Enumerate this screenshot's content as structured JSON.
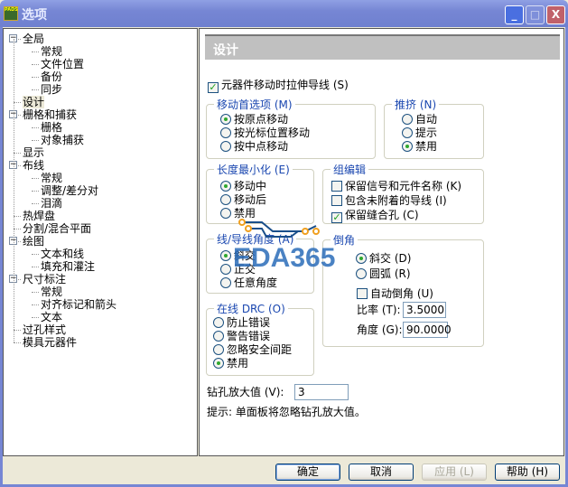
{
  "window": {
    "title": "选项",
    "icon_text": "PADS",
    "minimize": "_",
    "maximize": "□",
    "close": "X"
  },
  "tree": [
    {
      "label": "全局",
      "level": 0,
      "expanded": true
    },
    {
      "label": "常规",
      "level": 1
    },
    {
      "label": "文件位置",
      "level": 1
    },
    {
      "label": "备份",
      "level": 1
    },
    {
      "label": "同步",
      "level": 1
    },
    {
      "label": "设计",
      "level": 0,
      "selected": true
    },
    {
      "label": "栅格和捕获",
      "level": 0,
      "expanded": true
    },
    {
      "label": "栅格",
      "level": 1
    },
    {
      "label": "对象捕获",
      "level": 1
    },
    {
      "label": "显示",
      "level": 0
    },
    {
      "label": "布线",
      "level": 0,
      "expanded": true
    },
    {
      "label": "常规",
      "level": 1
    },
    {
      "label": "调整/差分对",
      "level": 1
    },
    {
      "label": "泪滴",
      "level": 1
    },
    {
      "label": "热焊盘",
      "level": 0
    },
    {
      "label": "分割/混合平面",
      "level": 0
    },
    {
      "label": "绘图",
      "level": 0,
      "expanded": true
    },
    {
      "label": "文本和线",
      "level": 1
    },
    {
      "label": "填充和灌注",
      "level": 1
    },
    {
      "label": "尺寸标注",
      "level": 0,
      "expanded": true
    },
    {
      "label": "常规",
      "level": 1
    },
    {
      "label": "对齐标记和箭头",
      "level": 1
    },
    {
      "label": "文本",
      "level": 1
    },
    {
      "label": "过孔样式",
      "level": 0
    },
    {
      "label": "模具元器件",
      "level": 0
    }
  ],
  "page": {
    "header": "设计",
    "stretch": {
      "label": "元器件移动时拉伸导线 (S)",
      "checked": true
    },
    "move_pref": {
      "title": "移动首选项 (M)",
      "options": [
        "按原点移动",
        "按光标位置移动",
        "按中点移动"
      ],
      "selected": 0
    },
    "push": {
      "title": "推挤 (N)",
      "options": [
        "自动",
        "提示",
        "禁用"
      ],
      "selected": 2
    },
    "length_min": {
      "title": "长度最小化 (E)",
      "options": [
        "移动中",
        "移动后",
        "禁用"
      ],
      "selected": 0
    },
    "group_edit": {
      "title": "组编辑",
      "options": [
        {
          "label": "保留信号和元件名称 (K)",
          "checked": false
        },
        {
          "label": "包含未附着的导线 (I)",
          "checked": false
        },
        {
          "label": "保留缝合孔 (C)",
          "checked": true
        }
      ]
    },
    "line_angle": {
      "title": "线/导线角度 (A)",
      "options": [
        "斜交",
        "正交",
        "任意角度"
      ],
      "selected": 0
    },
    "chamfer": {
      "title": "倒角",
      "options": [
        "斜交 (D)",
        "圆弧 (R)"
      ],
      "selected": 0,
      "auto_label": "自动倒角 (U)",
      "auto_checked": false,
      "ratio_label": "比率 (T):",
      "ratio": "3.5000",
      "angle_label": "角度 (G):",
      "angle": "90.0000"
    },
    "drc": {
      "title": "在线 DRC (O)",
      "options": [
        "防止错误",
        "警告错误",
        "忽略安全间距",
        "禁用"
      ],
      "selected": 3
    },
    "drill_label": "钻孔放大值 (V):",
    "drill_value": "3",
    "hint": "提示: 单面板将忽略钻孔放大值。"
  },
  "buttons": {
    "ok": "确定",
    "cancel": "取消",
    "apply": "应用 (L)",
    "help": "帮助 (H)"
  },
  "watermark": "EDA365"
}
